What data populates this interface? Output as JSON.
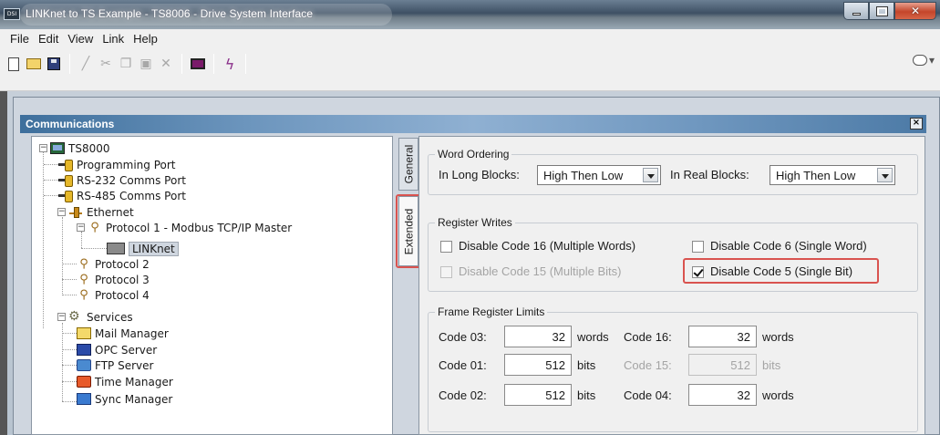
{
  "window": {
    "title": "LINKnet to TS Example - TS8006 - Drive System Interface",
    "app_icon_text": "DSI"
  },
  "menu": [
    "File",
    "Edit",
    "View",
    "Link",
    "Help"
  ],
  "toolbar": {
    "buttons": [
      "new-icon",
      "open-icon",
      "save-icon",
      "pen-icon",
      "cut-icon",
      "copy-icon",
      "paste-icon",
      "delete-icon",
      "monitor-icon",
      "bolt-icon"
    ],
    "right_glyph": "▾"
  },
  "child_window": {
    "title": "Communications",
    "close_glyph": "×"
  },
  "tree": {
    "root": "TS8000",
    "programming_port": "Programming Port",
    "rs232": "RS-232 Comms Port",
    "rs485": "RS-485 Comms Port",
    "ethernet": "Ethernet",
    "protocol1": "Protocol 1 - Modbus TCP/IP Master",
    "linknet": "LINKnet",
    "protocol2": "Protocol 2",
    "protocol3": "Protocol 3",
    "protocol4": "Protocol 4",
    "services": "Services",
    "mail": "Mail Manager",
    "opc": "OPC Server",
    "ftp": "FTP Server",
    "time": "Time Manager",
    "sync": "Sync Manager",
    "expander_collapsed": "−"
  },
  "tabs": {
    "general": "General",
    "extended": "Extended",
    "active": "Extended"
  },
  "word_ordering": {
    "title": "Word Ordering",
    "long_label": "In Long Blocks:",
    "long_value": "High Then Low",
    "real_label": "In Real Blocks:",
    "real_value": "High Then Low"
  },
  "register_writes": {
    "title": "Register Writes",
    "code16": {
      "label": "Disable Code 16 (Multiple Words)",
      "checked": false,
      "enabled": true
    },
    "code6": {
      "label": "Disable Code 6 (Single Word)",
      "checked": false,
      "enabled": true
    },
    "code15": {
      "label": "Disable Code 15 (Multiple Bits)",
      "checked": false,
      "enabled": false
    },
    "code5": {
      "label": "Disable Code 5 (Single Bit)",
      "checked": true,
      "enabled": true
    }
  },
  "frame_limits": {
    "title": "Frame Register Limits",
    "code03": {
      "label": "Code 03:",
      "value": "32",
      "unit": "words"
    },
    "code16": {
      "label": "Code 16:",
      "value": "32",
      "unit": "words"
    },
    "code01": {
      "label": "Code 01:",
      "value": "512",
      "unit": "bits"
    },
    "code15": {
      "label": "Code 15:",
      "value": "512",
      "unit": "bits",
      "enabled": false
    },
    "code02": {
      "label": "Code 02:",
      "value": "512",
      "unit": "bits"
    },
    "code04": {
      "label": "Code 04:",
      "value": "32",
      "unit": "words"
    }
  },
  "colors": {
    "highlight": "#d9534f",
    "title_bar": "#3e5064",
    "child_title": "#6c95bd"
  }
}
